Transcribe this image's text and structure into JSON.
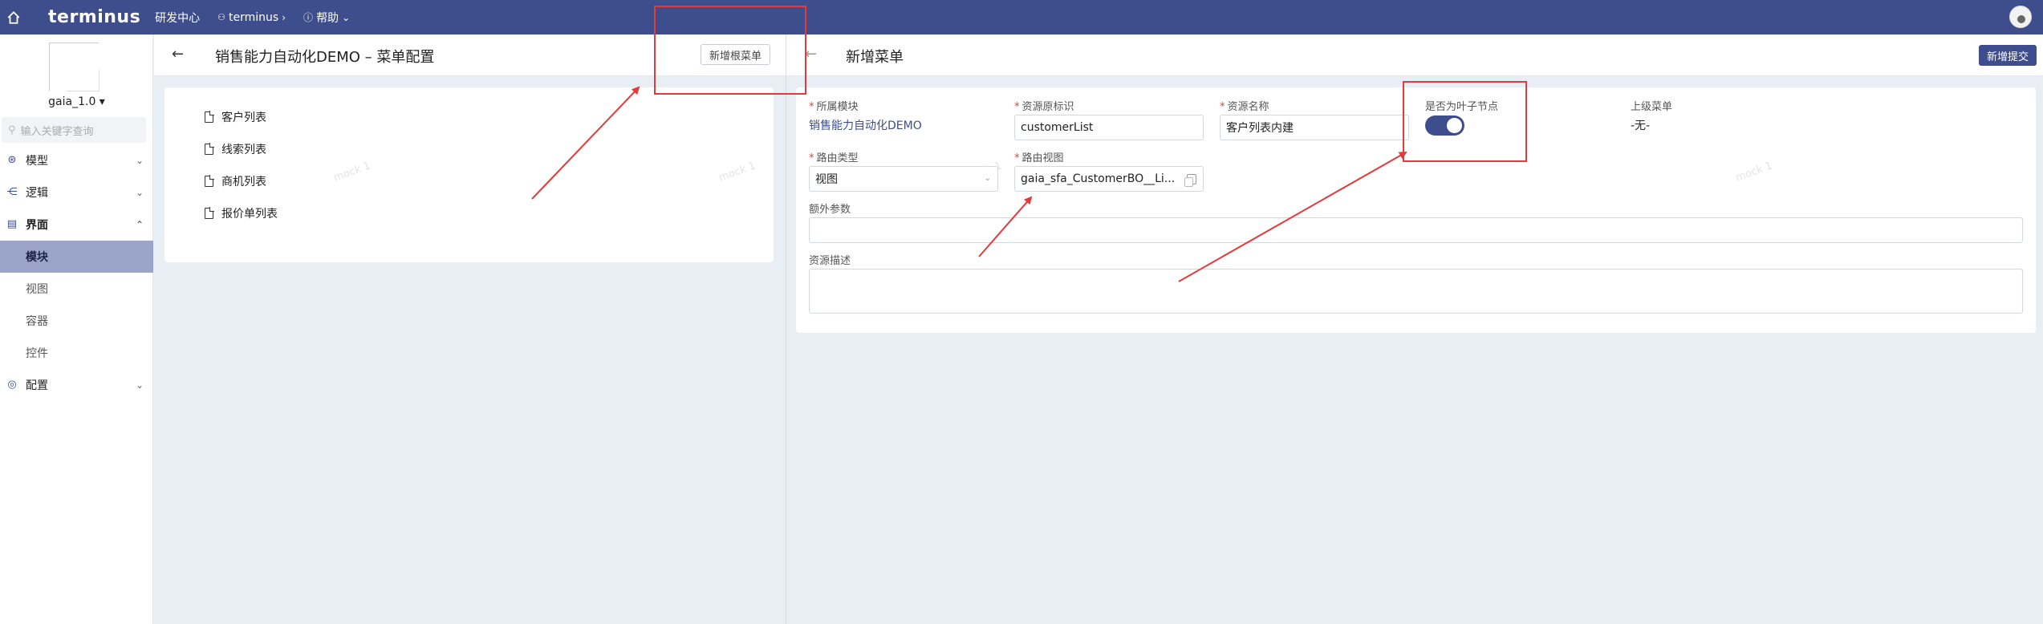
{
  "topbar": {
    "logo": "terminus",
    "nav": [
      {
        "label": "研发中心"
      },
      {
        "label": "terminus",
        "suffix": "›"
      },
      {
        "label": "帮助",
        "suffix": "⌄"
      }
    ]
  },
  "sidebar": {
    "app_version": "gaia_1.0 ▾",
    "search_placeholder": "输入关键字查询",
    "groups": [
      {
        "label": "模型",
        "chev": "⌄"
      },
      {
        "label": "逻辑",
        "chev": "⌄"
      },
      {
        "label": "界面",
        "chev": "⌃"
      },
      {
        "label": "配置",
        "chev": "⌄"
      }
    ],
    "sub_items": [
      "模块",
      "视图",
      "容器",
      "控件"
    ]
  },
  "left_panel": {
    "back": "←",
    "title": "销售能力自动化DEMO – 菜单配置",
    "add_root_button": "新增根菜单",
    "tree": [
      "客户列表",
      "线索列表",
      "商机列表",
      "报价单列表"
    ]
  },
  "right_panel": {
    "back": "←",
    "title": "新增菜单",
    "submit_button": "新增提交",
    "form": {
      "module_label": "所属模块",
      "module_value": "销售能力自动化DEMO",
      "resource_key_label": "资源原标识",
      "resource_key_value": "customerList",
      "resource_name_label": "资源名称",
      "resource_name_value": "客户列表内建",
      "is_leaf_label": "是否为叶子节点",
      "is_leaf_value": true,
      "parent_menu_label": "上级菜单",
      "parent_menu_value": "-无-",
      "route_type_label": "路由类型",
      "route_type_value": "视图",
      "route_view_label": "路由视图",
      "route_view_value": "gaia_sfa_CustomerBO__Li...",
      "extra_params_label": "额外参数",
      "extra_params_value": "",
      "description_label": "资源描述",
      "description_value": ""
    }
  },
  "watermark_text": "mock 1",
  "colors": {
    "topbar": "#3e4d8c",
    "accent": "#3e4d8c",
    "active_item": "#9aa5c9",
    "annotation": "#e23b3b"
  }
}
